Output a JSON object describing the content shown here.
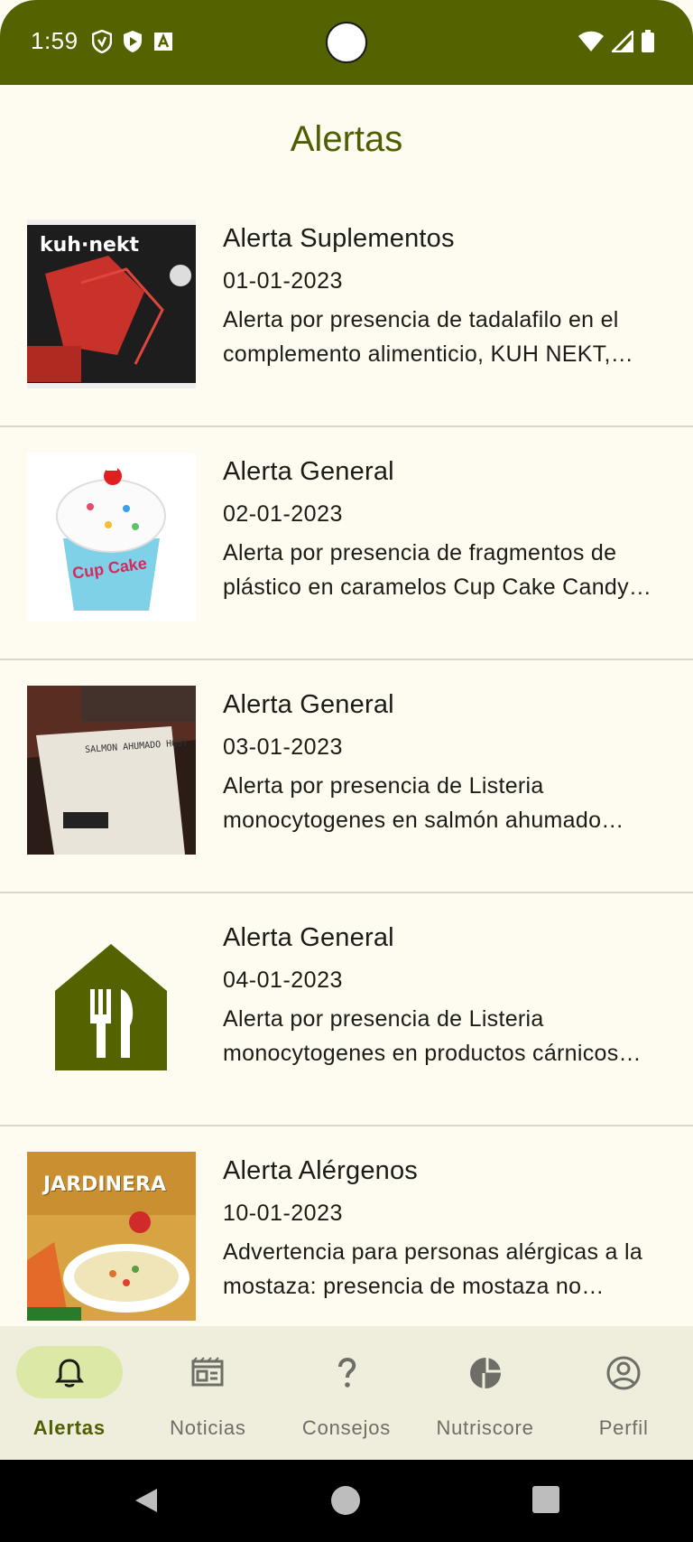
{
  "status_bar": {
    "time": "1:59",
    "icons_left": [
      "shield-icon",
      "play-protect-icon",
      "font-a-icon"
    ],
    "icons_right": [
      "wifi-icon",
      "signal-icon",
      "battery-icon"
    ]
  },
  "header": {
    "title": "Alertas"
  },
  "alerts": [
    {
      "title": "Alerta Suplementos",
      "date": "01-01-2023",
      "description": "Alerta por presencia de tadalafilo en el complemento alimenticio, KUH NEKT, procedente de",
      "thumb": "supplement-box",
      "thumb_text": "kuh·nekt"
    },
    {
      "title": "Alerta General",
      "date": "02-01-2023",
      "description": "Alerta por presencia de fragmentos de plástico en caramelos Cup Cake Candy procedentes de",
      "thumb": "cupcake-candy",
      "thumb_text": "Cup Cake"
    },
    {
      "title": "Alerta General",
      "date": "03-01-2023",
      "description": "Alerta por presencia de Listeria monocytogenes en salmón ahumado procedente de",
      "thumb": "smoked-salmon",
      "thumb_text": "SALMON AHUMADO HOST"
    },
    {
      "title": "Alerta General",
      "date": "04-01-2023",
      "description": "Alerta por presencia de Listeria monocytogenes en productos cárnicos procedentes de",
      "thumb": "food-house-icon",
      "thumb_text": ""
    },
    {
      "title": "Alerta Alérgenos",
      "date": "10-01-2023",
      "description": "Advertencia para personas alérgicas a la mostaza: presencia de mostaza no declarada en",
      "thumb": "soup-packet",
      "thumb_text": "JARDINERA"
    }
  ],
  "bottom_nav": [
    {
      "label": "Alertas",
      "icon": "bell-icon",
      "active": true
    },
    {
      "label": "Noticias",
      "icon": "newspaper-icon",
      "active": false
    },
    {
      "label": "Consejos",
      "icon": "question-icon",
      "active": false
    },
    {
      "label": "Nutriscore",
      "icon": "pie-chart-icon",
      "active": false
    },
    {
      "label": "Perfil",
      "icon": "account-circle-icon",
      "active": false
    }
  ],
  "colors": {
    "brand": "#546300",
    "background": "#fefbf1",
    "nav_background": "#efeedd",
    "active_pill": "#dbe8a6"
  }
}
